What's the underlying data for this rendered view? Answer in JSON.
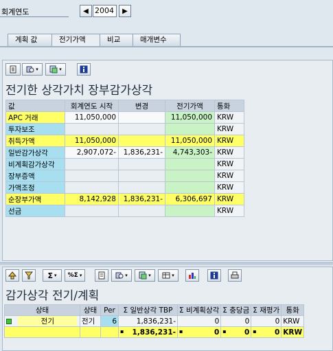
{
  "header": {
    "fiscal_year_label": "회계연도",
    "year": "2004"
  },
  "tabs": [
    {
      "label": "계획 값"
    },
    {
      "label": "전기가액"
    },
    {
      "label": "비교"
    },
    {
      "label": "매개변수"
    }
  ],
  "upper": {
    "title": "전기한 상각가치 장부감가상각",
    "columns": [
      "값",
      "회계연도 시작",
      "변경",
      "전기가액",
      "통화"
    ],
    "rows": [
      {
        "label": "APC 거래",
        "start": "11,050,000",
        "change": "",
        "posted": "11,050,000",
        "cur": "KRW"
      },
      {
        "label": "투자보조",
        "start": "",
        "change": "",
        "posted": "",
        "cur": "KRW"
      },
      {
        "label": "취득가액",
        "start": "11,050,000",
        "change": "",
        "posted": "11,050,000",
        "cur": "KRW"
      },
      {
        "label": "일반감가상각",
        "start": "2,907,072-",
        "change": "1,836,231-",
        "posted": "4,743,303-",
        "cur": "KRW"
      },
      {
        "label": "비계획감가상각",
        "start": "",
        "change": "",
        "posted": "",
        "cur": "KRW"
      },
      {
        "label": "장부증액",
        "start": "",
        "change": "",
        "posted": "",
        "cur": "KRW"
      },
      {
        "label": "가액조정",
        "start": "",
        "change": "",
        "posted": "",
        "cur": "KRW"
      },
      {
        "label": "순장부가액",
        "start": "8,142,928",
        "change": "1,836,231-",
        "posted": "6,306,697",
        "cur": "KRW"
      },
      {
        "label": "선금",
        "start": "",
        "change": "",
        "posted": "",
        "cur": "KRW"
      }
    ]
  },
  "lower": {
    "title": "감가상각 전기/계획",
    "columns": [
      "상태",
      "상태",
      "Per",
      "Σ 일반상각 TBP",
      "Σ 비계획상각",
      "Σ 충당금",
      "Σ 재평가",
      "통화"
    ],
    "row": {
      "status_text": "전기",
      "status2": "전기",
      "per": "6",
      "ordinary": "1,836,231-",
      "unplanned": "0",
      "reserve": "0",
      "reval": "0",
      "cur": "KRW"
    },
    "total": {
      "marker": "▪",
      "ordinary": "1,836,231-",
      "unplanned": "0",
      "reserve": "0",
      "reval": "0",
      "cur": "KRW"
    }
  },
  "colors": {
    "label_cyan": "#a8dff0",
    "yellow": "#ffff66",
    "green": "#c9f3c4",
    "status_green": "#43c33a"
  }
}
